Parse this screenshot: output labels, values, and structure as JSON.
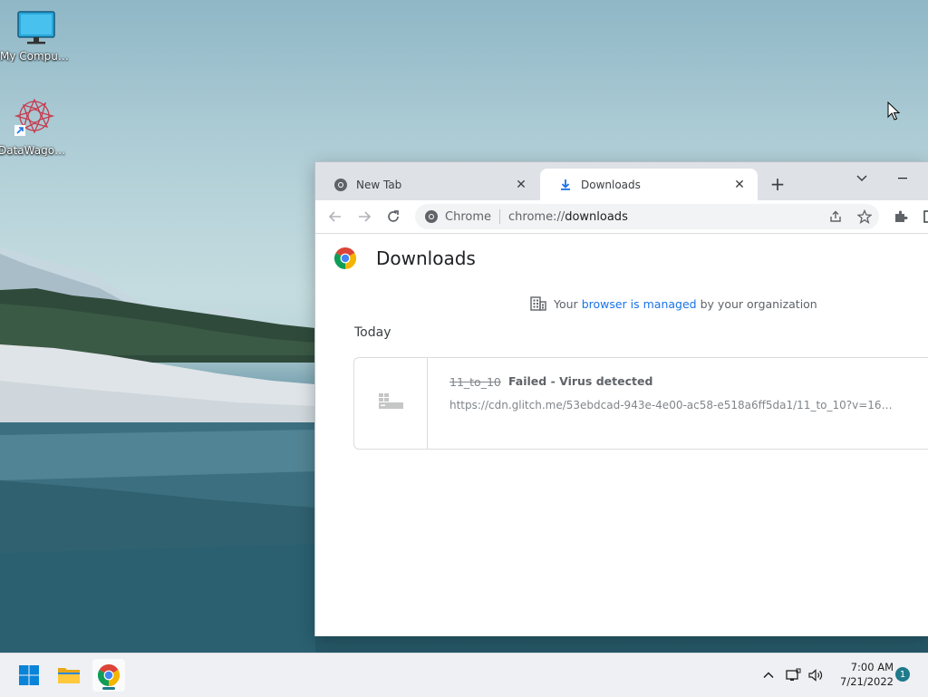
{
  "desktop": {
    "icons": [
      {
        "label": "My Computer",
        "icon": "monitor-icon"
      },
      {
        "label": "DataWagon...",
        "icon": "datawagon-app-icon"
      }
    ]
  },
  "browser": {
    "tabs": [
      {
        "title": "New Tab",
        "icon": "chrome-icon",
        "active": false
      },
      {
        "title": "Downloads",
        "icon": "download-icon",
        "active": true
      }
    ],
    "new_tab_label": "+",
    "omnibox": {
      "chip": "Chrome",
      "url_scheme": "chrome://",
      "url_host": "downloads"
    }
  },
  "downloads_page": {
    "title": "Downloads",
    "managed_notice": {
      "prefix": "Your",
      "link": "browser is managed",
      "suffix": "by your organization"
    },
    "section_date": "Today",
    "items": [
      {
        "file_name": "11_to_10",
        "status": "Failed - Virus detected",
        "url": "https://cdn.glitch.me/53ebdcad-943e-4e00-ac58-e518a6ff5da1/11_to_10?v=165838..."
      }
    ]
  },
  "taskbar": {
    "apps": [
      "start-icon",
      "file-explorer-icon",
      "chrome-icon"
    ],
    "clock": {
      "time": "7:00 AM",
      "date": "7/21/2022"
    },
    "notification_count": "1"
  },
  "colors": {
    "accent": "#1a73e8",
    "tabstrip": "#dee1e6",
    "taskbar": "#eef0f3"
  }
}
